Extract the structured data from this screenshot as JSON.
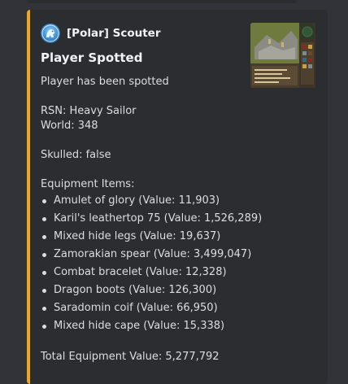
{
  "embed": {
    "accent_color": "#f0a71f",
    "author": {
      "name": "[Polar] Scouter",
      "icon": "polar-bear-icon"
    },
    "title": "Player Spotted",
    "description": {
      "intro": "Player has been spotted",
      "rsn": "RSN: Heavy Sailor",
      "world": "World: 348",
      "skulled": "Skulled: false",
      "equipment_header": "Equipment Items:",
      "items": [
        "Amulet of glory (Value: 11,903)",
        "Karil's leathertop 75 (Value: 1,526,289)",
        "Mixed hide legs (Value: 19,637)",
        "Zamorakian spear (Value: 3,499,047)",
        "Combat bracelet (Value: 12,328)",
        "Dragon boots (Value: 126,300)",
        "Saradomin coif (Value: 66,950)",
        "Mixed hide cape (Value: 15,338)"
      ],
      "total": "Total Equipment Value: 5,277,792"
    }
  },
  "colors": {
    "background": "#313338",
    "embed_background": "#2b2d31",
    "text": "#dbdee1",
    "heading": "#f2f3f5"
  }
}
